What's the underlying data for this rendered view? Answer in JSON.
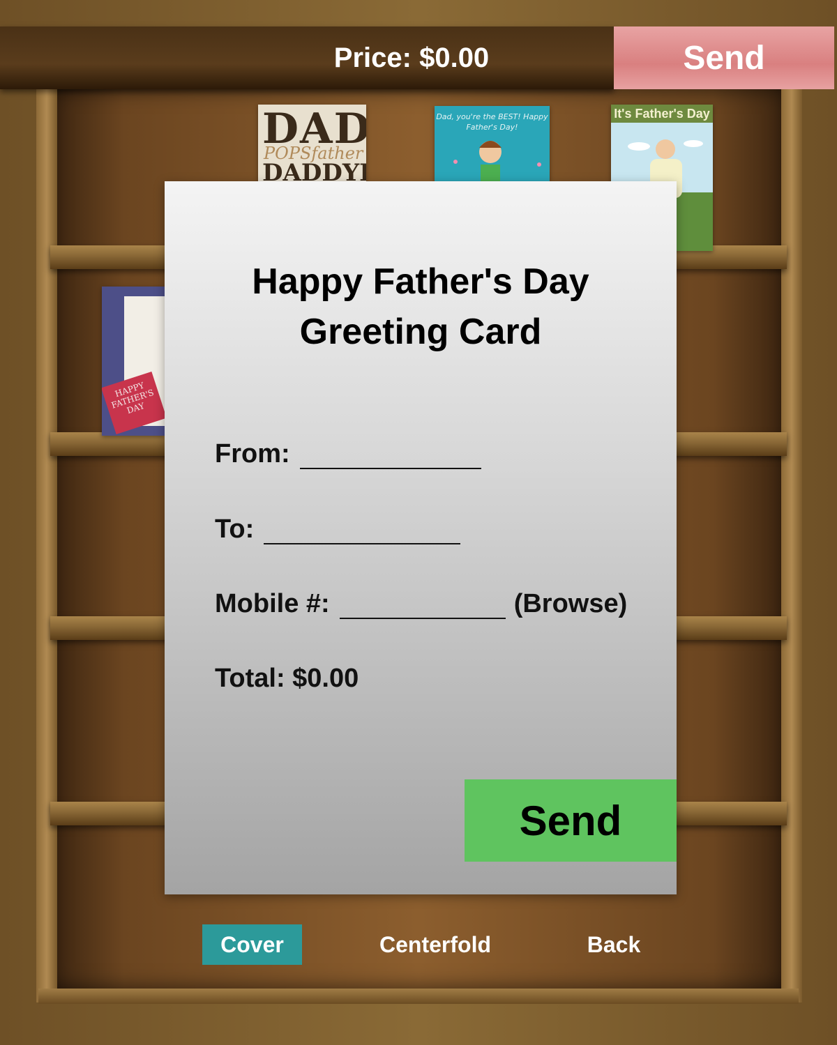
{
  "header": {
    "price_text": "Price: $0.00",
    "send_label": "Send"
  },
  "thumbnails": {
    "dad": {
      "line1": "DAD",
      "line2": "POPSfather",
      "line3": "DADDYPA"
    },
    "boy": {
      "text": "Dad, you're the BEST! Happy Father's Day!"
    },
    "golf": {
      "title": "It's Father's Day !"
    },
    "fathers": {
      "tag": "HAPPY FATHER'S DAY"
    }
  },
  "form": {
    "title_line1": "Happy Father's Day",
    "title_line2": "Greeting Card",
    "from_label": "From:",
    "from_value": "",
    "to_label": "To:",
    "to_value": "",
    "mobile_label": "Mobile #:",
    "mobile_value": "",
    "browse_label": "(Browse)",
    "total_label": "Total: $0.00",
    "send_label": "Send"
  },
  "tabs": [
    {
      "label": "Cover",
      "active": true
    },
    {
      "label": "Centerfold",
      "active": false
    },
    {
      "label": "Back",
      "active": false
    }
  ],
  "colors": {
    "top_send_bg": "#d98080",
    "modal_send_bg": "#5fc45f",
    "active_tab_bg": "#2c9a9a"
  }
}
